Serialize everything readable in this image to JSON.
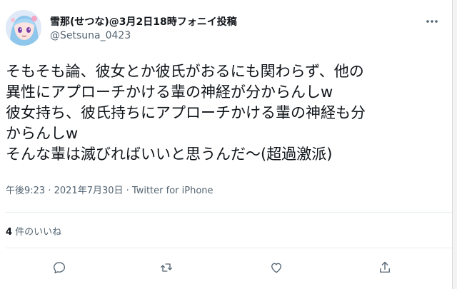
{
  "author": {
    "name": "雪那(せつな)@3月2日18時フォニイ投稿",
    "handle": "@Setsuna_0423",
    "avatar_icon": "avatar-anime-girl"
  },
  "tweet": {
    "lines": [
      "そもそも論、彼女とか彼氏がおるにも関わらず、他の",
      "異性にアプローチかける輩の神経が分からんしw",
      "彼女持ち、彼氏持ちにアプローチかける輩の神経も分",
      "からんしw",
      "そんな輩は滅びればいいと思うんだ～(超過激派)"
    ]
  },
  "meta": {
    "time": "午後9:23",
    "separator1": " · ",
    "date": "2021年7月30日",
    "separator2": " · ",
    "source": "Twitter for iPhone"
  },
  "stats": {
    "likes_count": "4",
    "likes_label": " 件のいいね"
  },
  "actions": {
    "reply_icon": "comment-icon",
    "retweet_icon": "retweet-icon",
    "like_icon": "heart-icon",
    "share_icon": "share-icon",
    "more_icon": "more-icon"
  },
  "colors": {
    "text": "#0f1419",
    "secondary": "#536471",
    "divider": "#e6ecf0"
  }
}
